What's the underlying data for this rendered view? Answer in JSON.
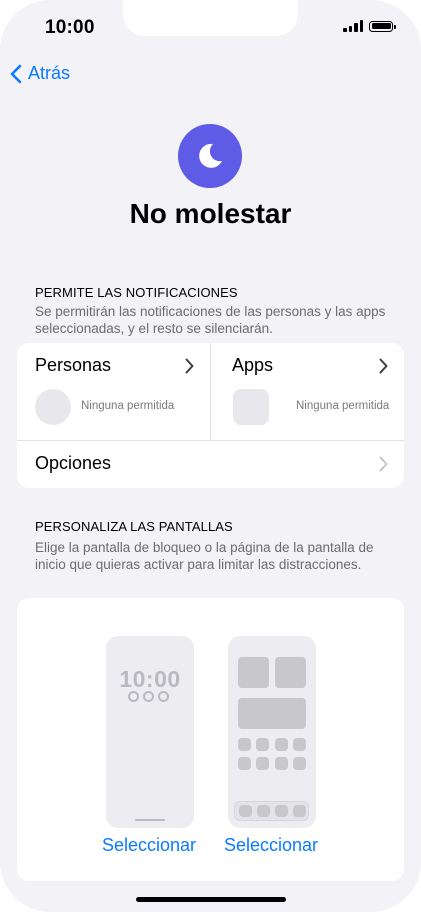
{
  "status_bar": {
    "time": "10:00"
  },
  "nav": {
    "back_label": "Atrás"
  },
  "header": {
    "title": "No molestar",
    "icon": "moon-icon",
    "icon_color": "#5e5ce6"
  },
  "allow_section": {
    "header": "PERMITE LAS NOTIFICACIONES",
    "description": "Se permitirán las notificaciones de las personas y las apps seleccionadas, y el resto se silenciarán.",
    "people": {
      "label": "Personas",
      "status": "Ninguna permitida"
    },
    "apps": {
      "label": "Apps",
      "status": "Ninguna permitida"
    },
    "options_label": "Opciones"
  },
  "screens_section": {
    "header": "PERSONALIZA LAS PANTALLAS",
    "description": "Elige la pantalla de bloqueo o la página de la pantalla de inicio que quieras activar para limitar las distracciones.",
    "lock_screen_time": "10:00",
    "lock_select_label": "Seleccionar",
    "home_select_label": "Seleccionar"
  },
  "colors": {
    "accent": "#0a7aff",
    "background": "#f2f2f7"
  }
}
